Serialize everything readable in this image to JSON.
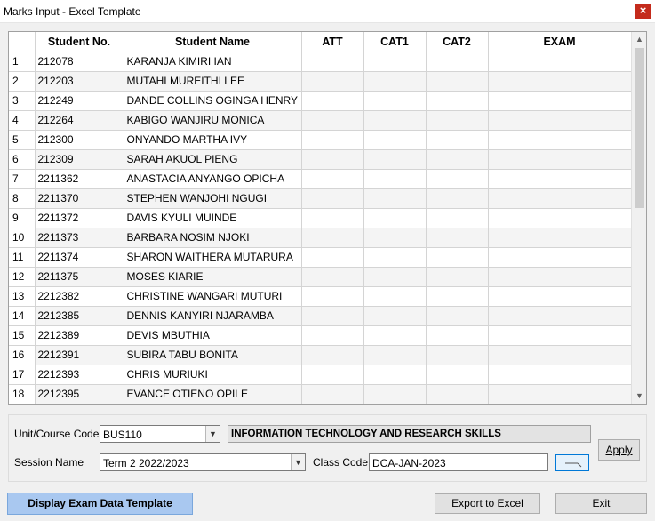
{
  "window": {
    "title": "Marks Input - Excel Template",
    "close_glyph": "×"
  },
  "grid": {
    "columns": [
      "",
      "Student No.",
      "Student Name",
      "ATT",
      "CAT1",
      "CAT2",
      "EXAM"
    ],
    "rows": [
      {
        "n": "1",
        "no": "212078",
        "name": "KARANJA KIMIRI IAN"
      },
      {
        "n": "2",
        "no": "212203",
        "name": "MUTAHI MUREITHI LEE"
      },
      {
        "n": "3",
        "no": "212249",
        "name": "DANDE COLLINS OGINGA HENRY"
      },
      {
        "n": "4",
        "no": "212264",
        "name": "KABIGO WANJIRU MONICA"
      },
      {
        "n": "5",
        "no": "212300",
        "name": "ONYANDO MARTHA IVY"
      },
      {
        "n": "6",
        "no": "212309",
        "name": "SARAH AKUOL PIENG"
      },
      {
        "n": "7",
        "no": "2211362",
        "name": "ANASTACIA ANYANGO OPICHA"
      },
      {
        "n": "8",
        "no": "2211370",
        "name": "STEPHEN WANJOHI NGUGI"
      },
      {
        "n": "9",
        "no": "2211372",
        "name": "DAVIS KYULI MUINDE"
      },
      {
        "n": "10",
        "no": "2211373",
        "name": "BARBARA NOSIM NJOKI"
      },
      {
        "n": "11",
        "no": "2211374",
        "name": "SHARON WAITHERA MUTARURA"
      },
      {
        "n": "12",
        "no": "2211375",
        "name": "MOSES KIARIE"
      },
      {
        "n": "13",
        "no": "2212382",
        "name": "CHRISTINE WANGARI MUTURI"
      },
      {
        "n": "14",
        "no": "2212385",
        "name": "DENNIS KANYIRI NJARAMBA"
      },
      {
        "n": "15",
        "no": "2212389",
        "name": "DEVIS MBUTHIA"
      },
      {
        "n": "16",
        "no": "2212391",
        "name": "SUBIRA TABU BONITA"
      },
      {
        "n": "17",
        "no": "2212393",
        "name": "CHRIS MURIUKI"
      },
      {
        "n": "18",
        "no": "2212395",
        "name": "EVANCE OTIENO OPILE"
      }
    ]
  },
  "form": {
    "unit_label": "Unit/Course Code",
    "unit_value": "BUS110",
    "course_name": "INFORMATION TECHNOLOGY AND RESEARCH SKILLS",
    "session_label": "Session Name",
    "session_value": "Term 2 2022/2023",
    "class_label": "Class Code",
    "class_value": "DCA-JAN-2023",
    "apply_label": "Apply"
  },
  "footer": {
    "display_label": "Display Exam Data Template",
    "export_label": "Export to Excel",
    "exit_label": "Exit"
  },
  "colors": {
    "accent_button": "#a9c8f0",
    "close": "#c42b1c"
  }
}
